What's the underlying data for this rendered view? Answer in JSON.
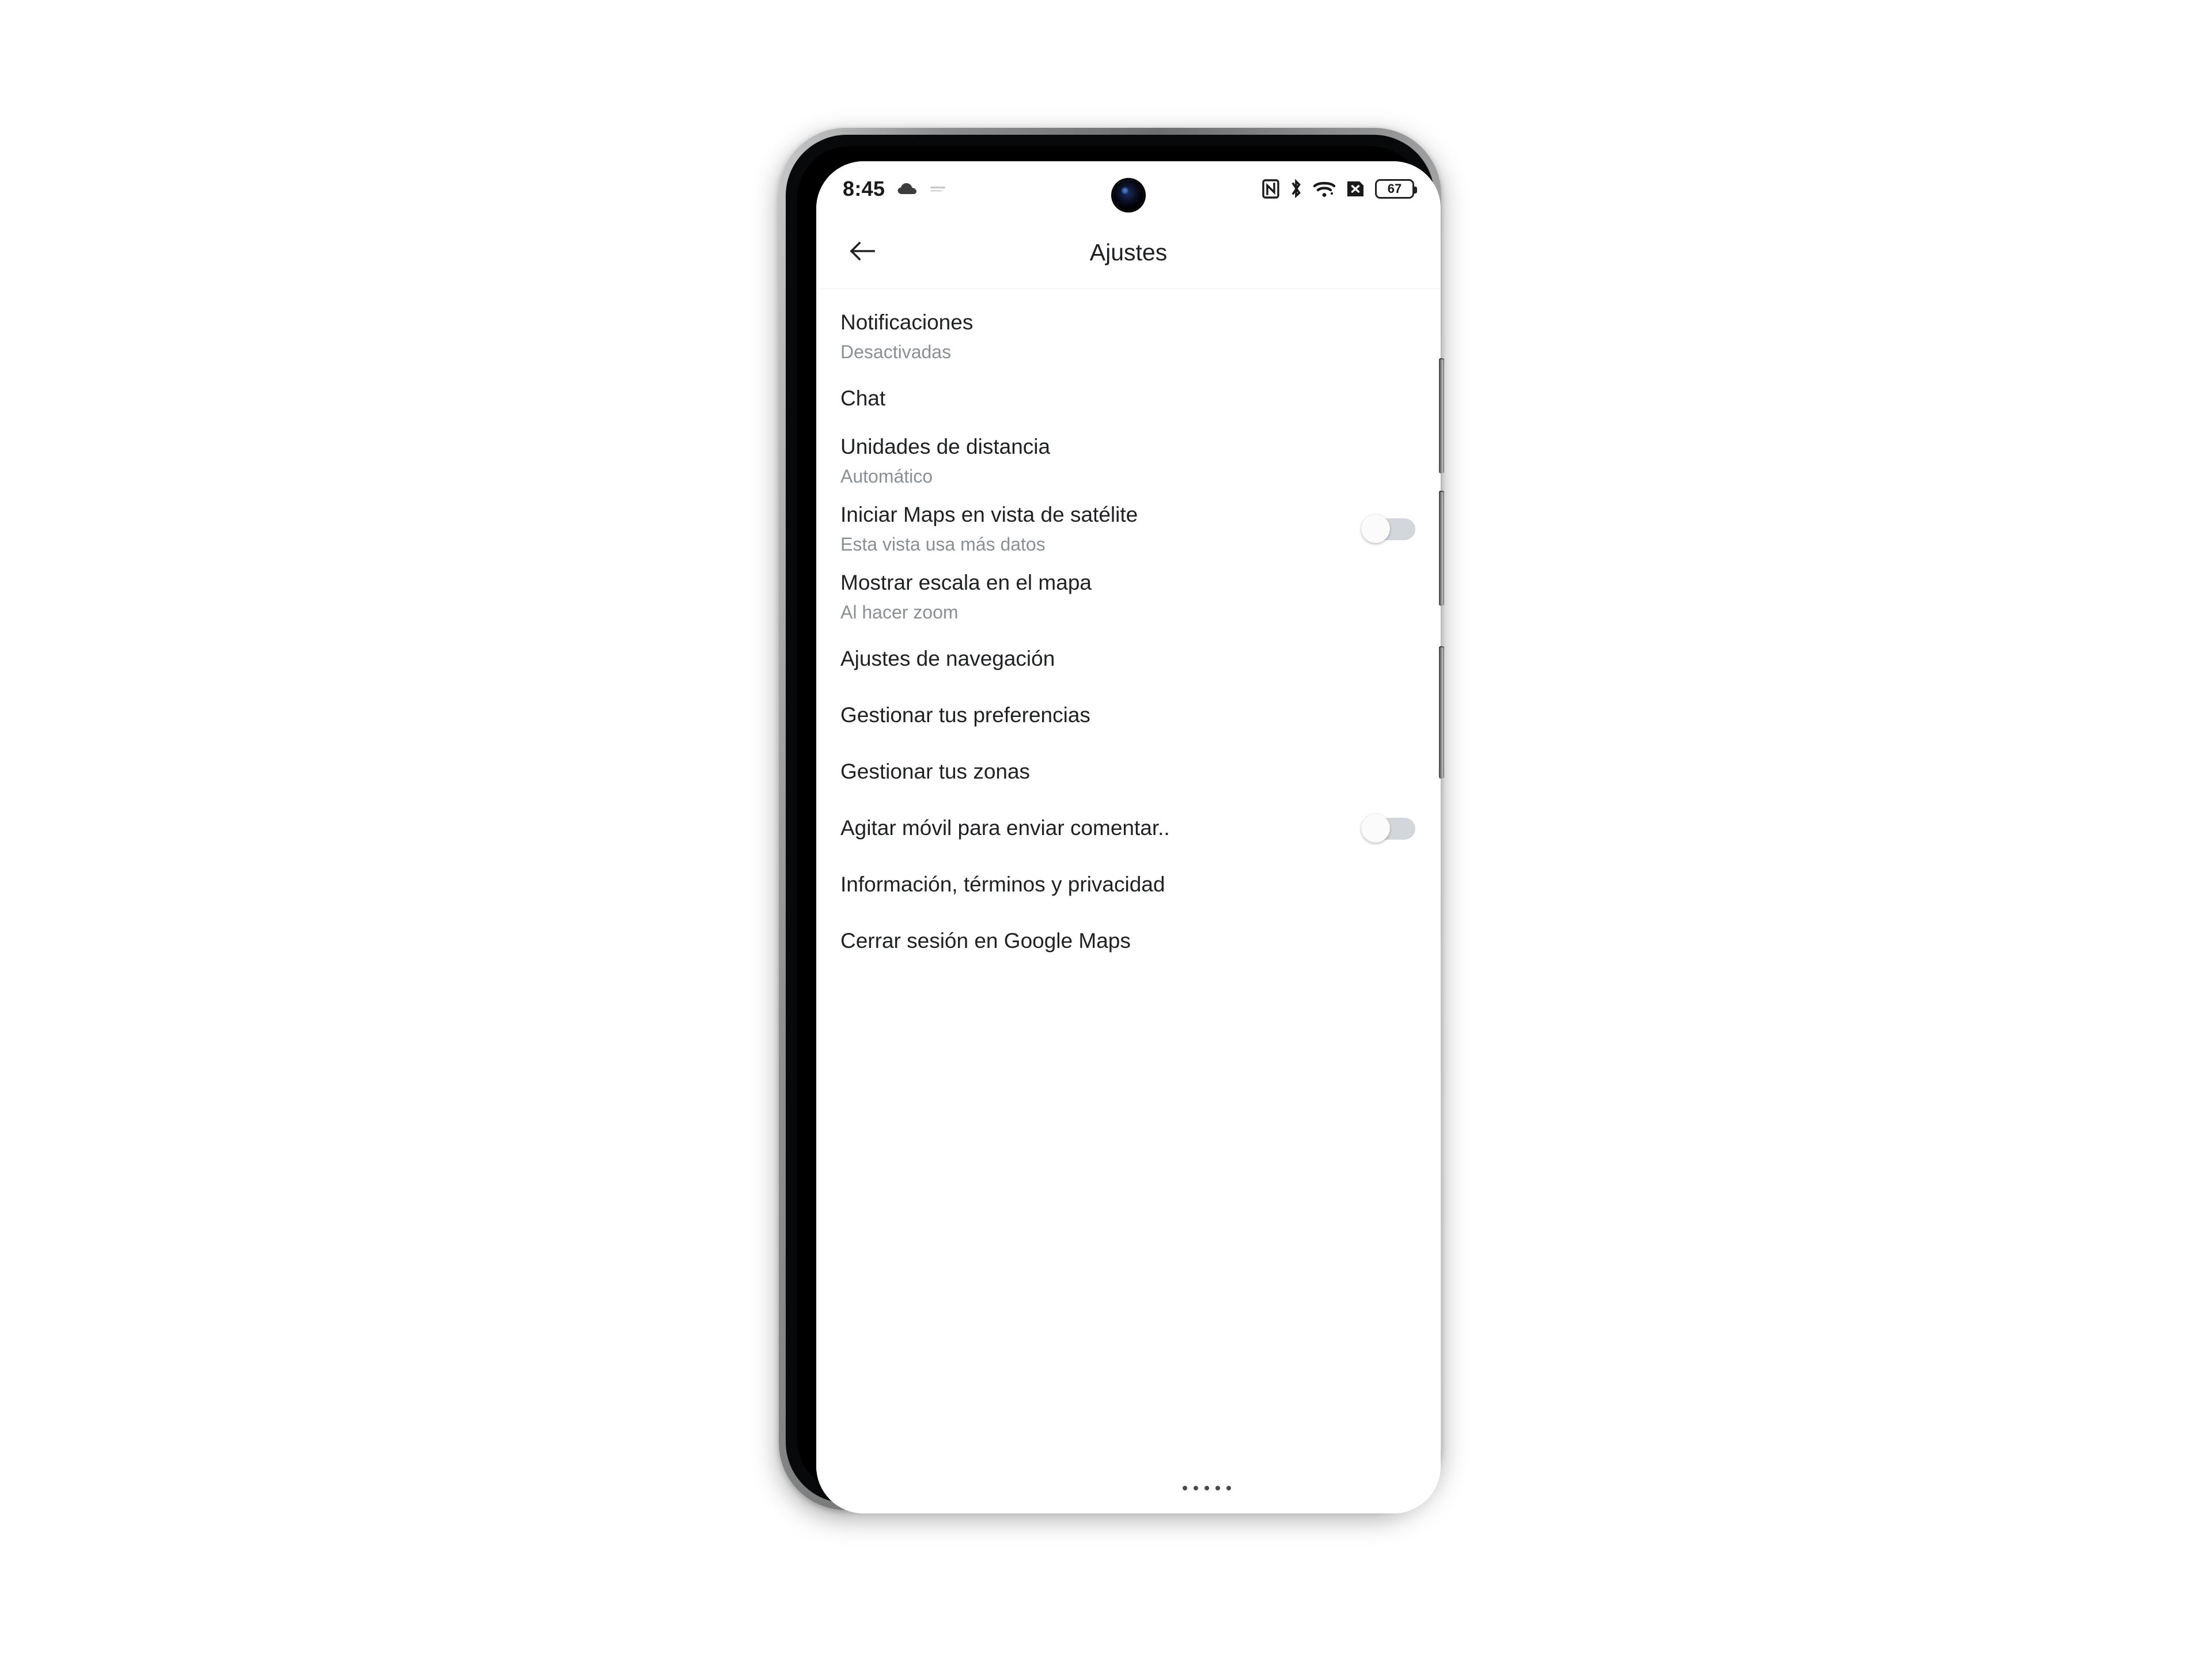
{
  "status_bar": {
    "clock": "8:45",
    "left_icons": [
      "cloud-icon",
      "faint-notification-icon"
    ],
    "right_icons": [
      "nfc-icon",
      "bluetooth-icon",
      "wifi-icon",
      "no-sim-icon"
    ],
    "battery_level": "67"
  },
  "app_bar": {
    "title": "Ajustes",
    "back_icon": "arrow-left-icon"
  },
  "settings": [
    {
      "title": "Notificaciones",
      "subtitle": "Desactivadas",
      "control": "none"
    },
    {
      "title": "Chat",
      "subtitle": "",
      "control": "none"
    },
    {
      "title": "Unidades de distancia",
      "subtitle": "Automático",
      "control": "none"
    },
    {
      "title": "Iniciar Maps en vista de satélite",
      "subtitle": "Esta vista usa más datos",
      "control": "toggle",
      "toggle_state": "off"
    },
    {
      "title": "Mostrar escala en el mapa",
      "subtitle": "Al hacer zoom",
      "control": "none"
    },
    {
      "title": "Ajustes de navegación",
      "subtitle": "",
      "control": "none"
    },
    {
      "title": "Gestionar tus preferencias",
      "subtitle": "",
      "control": "none"
    },
    {
      "title": "Gestionar tus zonas",
      "subtitle": "",
      "control": "none"
    },
    {
      "title": "Agitar móvil para enviar comentar..",
      "subtitle": "",
      "control": "toggle",
      "toggle_state": "off"
    },
    {
      "title": "Información, términos y privacidad",
      "subtitle": "",
      "control": "none"
    },
    {
      "title": "Cerrar sesión en Google Maps",
      "subtitle": "",
      "control": "none"
    }
  ],
  "colors": {
    "background": "#ffffff",
    "title_text": "#202124",
    "subtitle_text": "#8a8f95",
    "toggle_track_off": "#d3d7db",
    "toggle_thumb_off": "#fbfbfb",
    "divider": "#eceff1"
  }
}
